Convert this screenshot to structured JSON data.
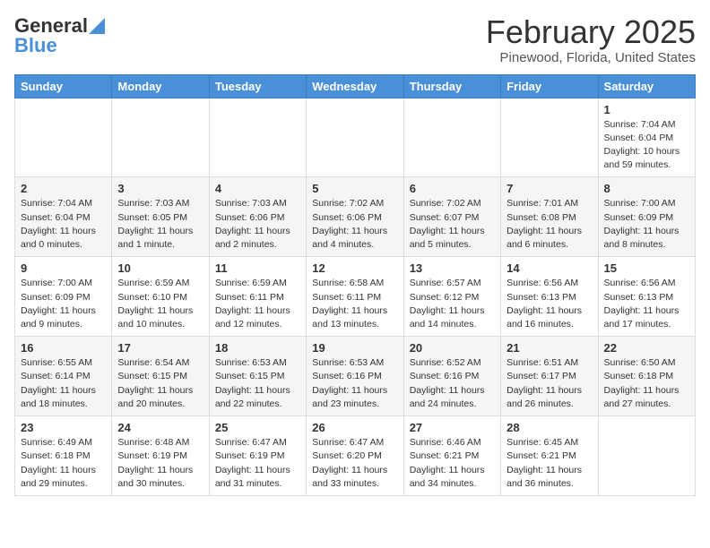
{
  "header": {
    "logo_general": "General",
    "logo_blue": "Blue",
    "month_title": "February 2025",
    "location": "Pinewood, Florida, United States"
  },
  "days_of_week": [
    "Sunday",
    "Monday",
    "Tuesday",
    "Wednesday",
    "Thursday",
    "Friday",
    "Saturday"
  ],
  "weeks": [
    [
      {
        "day": "",
        "info": ""
      },
      {
        "day": "",
        "info": ""
      },
      {
        "day": "",
        "info": ""
      },
      {
        "day": "",
        "info": ""
      },
      {
        "day": "",
        "info": ""
      },
      {
        "day": "",
        "info": ""
      },
      {
        "day": "1",
        "info": "Sunrise: 7:04 AM\nSunset: 6:04 PM\nDaylight: 10 hours\nand 59 minutes."
      }
    ],
    [
      {
        "day": "2",
        "info": "Sunrise: 7:04 AM\nSunset: 6:04 PM\nDaylight: 11 hours\nand 0 minutes."
      },
      {
        "day": "3",
        "info": "Sunrise: 7:03 AM\nSunset: 6:05 PM\nDaylight: 11 hours\nand 1 minute."
      },
      {
        "day": "4",
        "info": "Sunrise: 7:03 AM\nSunset: 6:06 PM\nDaylight: 11 hours\nand 2 minutes."
      },
      {
        "day": "5",
        "info": "Sunrise: 7:02 AM\nSunset: 6:06 PM\nDaylight: 11 hours\nand 4 minutes."
      },
      {
        "day": "6",
        "info": "Sunrise: 7:02 AM\nSunset: 6:07 PM\nDaylight: 11 hours\nand 5 minutes."
      },
      {
        "day": "7",
        "info": "Sunrise: 7:01 AM\nSunset: 6:08 PM\nDaylight: 11 hours\nand 6 minutes."
      },
      {
        "day": "8",
        "info": "Sunrise: 7:00 AM\nSunset: 6:09 PM\nDaylight: 11 hours\nand 8 minutes."
      }
    ],
    [
      {
        "day": "9",
        "info": "Sunrise: 7:00 AM\nSunset: 6:09 PM\nDaylight: 11 hours\nand 9 minutes."
      },
      {
        "day": "10",
        "info": "Sunrise: 6:59 AM\nSunset: 6:10 PM\nDaylight: 11 hours\nand 10 minutes."
      },
      {
        "day": "11",
        "info": "Sunrise: 6:59 AM\nSunset: 6:11 PM\nDaylight: 11 hours\nand 12 minutes."
      },
      {
        "day": "12",
        "info": "Sunrise: 6:58 AM\nSunset: 6:11 PM\nDaylight: 11 hours\nand 13 minutes."
      },
      {
        "day": "13",
        "info": "Sunrise: 6:57 AM\nSunset: 6:12 PM\nDaylight: 11 hours\nand 14 minutes."
      },
      {
        "day": "14",
        "info": "Sunrise: 6:56 AM\nSunset: 6:13 PM\nDaylight: 11 hours\nand 16 minutes."
      },
      {
        "day": "15",
        "info": "Sunrise: 6:56 AM\nSunset: 6:13 PM\nDaylight: 11 hours\nand 17 minutes."
      }
    ],
    [
      {
        "day": "16",
        "info": "Sunrise: 6:55 AM\nSunset: 6:14 PM\nDaylight: 11 hours\nand 18 minutes."
      },
      {
        "day": "17",
        "info": "Sunrise: 6:54 AM\nSunset: 6:15 PM\nDaylight: 11 hours\nand 20 minutes."
      },
      {
        "day": "18",
        "info": "Sunrise: 6:53 AM\nSunset: 6:15 PM\nDaylight: 11 hours\nand 22 minutes."
      },
      {
        "day": "19",
        "info": "Sunrise: 6:53 AM\nSunset: 6:16 PM\nDaylight: 11 hours\nand 23 minutes."
      },
      {
        "day": "20",
        "info": "Sunrise: 6:52 AM\nSunset: 6:16 PM\nDaylight: 11 hours\nand 24 minutes."
      },
      {
        "day": "21",
        "info": "Sunrise: 6:51 AM\nSunset: 6:17 PM\nDaylight: 11 hours\nand 26 minutes."
      },
      {
        "day": "22",
        "info": "Sunrise: 6:50 AM\nSunset: 6:18 PM\nDaylight: 11 hours\nand 27 minutes."
      }
    ],
    [
      {
        "day": "23",
        "info": "Sunrise: 6:49 AM\nSunset: 6:18 PM\nDaylight: 11 hours\nand 29 minutes."
      },
      {
        "day": "24",
        "info": "Sunrise: 6:48 AM\nSunset: 6:19 PM\nDaylight: 11 hours\nand 30 minutes."
      },
      {
        "day": "25",
        "info": "Sunrise: 6:47 AM\nSunset: 6:19 PM\nDaylight: 11 hours\nand 31 minutes."
      },
      {
        "day": "26",
        "info": "Sunrise: 6:47 AM\nSunset: 6:20 PM\nDaylight: 11 hours\nand 33 minutes."
      },
      {
        "day": "27",
        "info": "Sunrise: 6:46 AM\nSunset: 6:21 PM\nDaylight: 11 hours\nand 34 minutes."
      },
      {
        "day": "28",
        "info": "Sunrise: 6:45 AM\nSunset: 6:21 PM\nDaylight: 11 hours\nand 36 minutes."
      },
      {
        "day": "",
        "info": ""
      }
    ]
  ]
}
